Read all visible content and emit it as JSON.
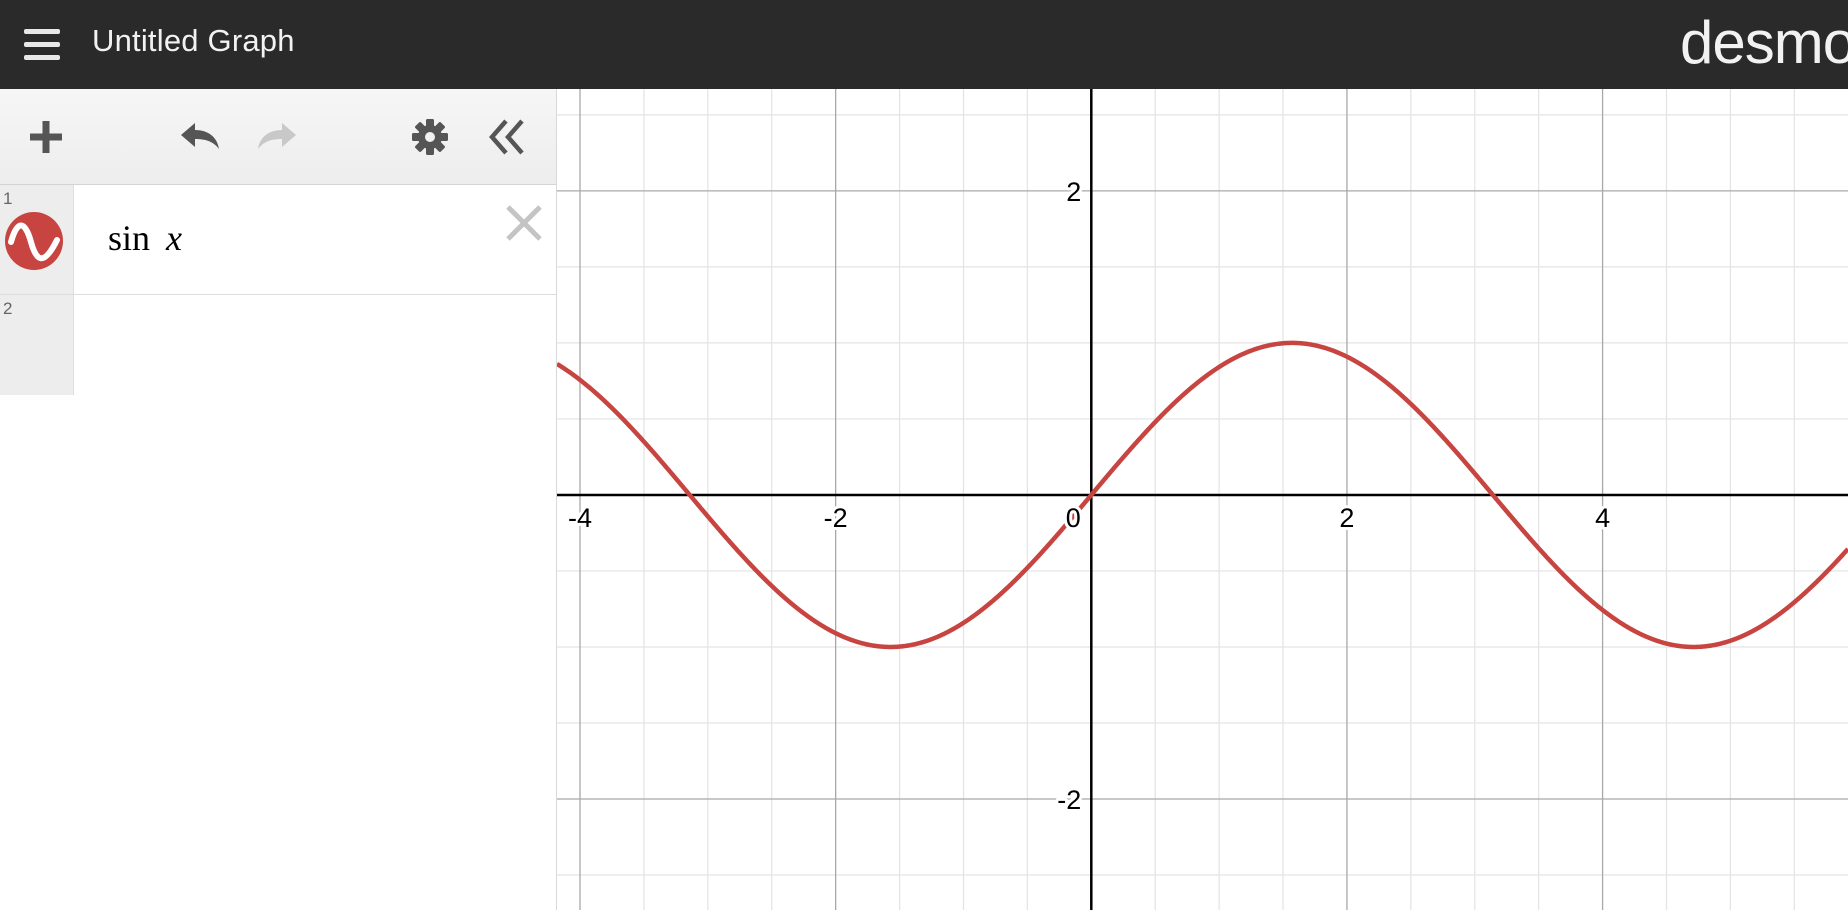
{
  "header": {
    "title": "Untitled Graph",
    "brand": "desmos",
    "menu_icon": "hamburger-menu-icon"
  },
  "toolbar": {
    "add_icon": "plus-icon",
    "undo_icon": "undo-icon",
    "redo_icon": "redo-icon",
    "settings_icon": "gear-icon",
    "collapse_icon": "double-chevron-left-icon"
  },
  "expressions": [
    {
      "index": "1",
      "func": "sin",
      "var": "x",
      "color": "#c74440"
    },
    {
      "index": "2",
      "func": "",
      "var": "",
      "color": ""
    }
  ],
  "colors": {
    "header_bg": "#2a2a2a",
    "curve": "#c74440",
    "icon_disabled": "#c8c8c8",
    "icon_active": "#555555"
  },
  "chart_data": {
    "type": "line",
    "series": [
      {
        "expression": "sin x",
        "color": "#c74440"
      }
    ],
    "xlim": [
      -4.18,
      5.92
    ],
    "ylim": [
      -2.73,
      2.67
    ],
    "x_ticks": [
      -4,
      -2,
      0,
      2,
      4
    ],
    "y_ticks": [
      2,
      -2
    ],
    "x_tick_labels": [
      "-4",
      "-2",
      "0",
      "2",
      "4"
    ],
    "y_tick_labels": [
      "2",
      "-2"
    ],
    "major_step": 2,
    "minor_step": 0.5,
    "grid": true
  }
}
